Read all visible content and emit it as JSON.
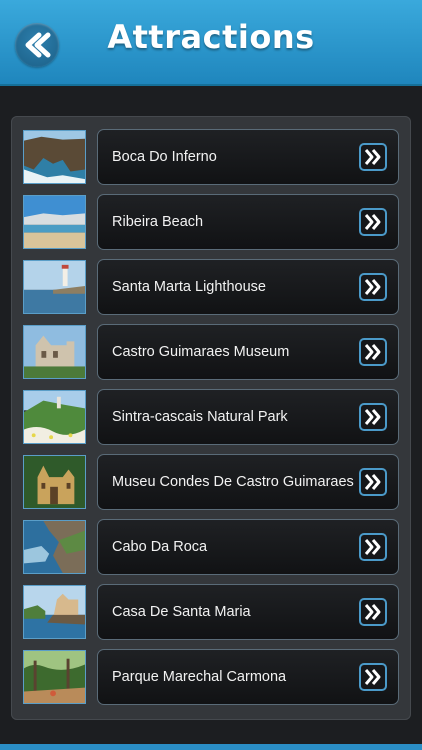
{
  "header": {
    "title": "Attractions",
    "back_icon": "double-chevron-left-icon",
    "accent_color": "#2a97cf"
  },
  "list": {
    "item_icon": "double-chevron-right-icon",
    "items": [
      {
        "label": "Boca Do Inferno"
      },
      {
        "label": "Ribeira Beach"
      },
      {
        "label": "Santa Marta Lighthouse"
      },
      {
        "label": "Castro Guimaraes Museum"
      },
      {
        "label": "Sintra-cascais Natural Park"
      },
      {
        "label": "Museu Condes De Castro Guimaraes"
      },
      {
        "label": "Cabo Da Roca"
      },
      {
        "label": "Casa De Santa Maria"
      },
      {
        "label": "Parque Marechal Carmona"
      }
    ]
  }
}
